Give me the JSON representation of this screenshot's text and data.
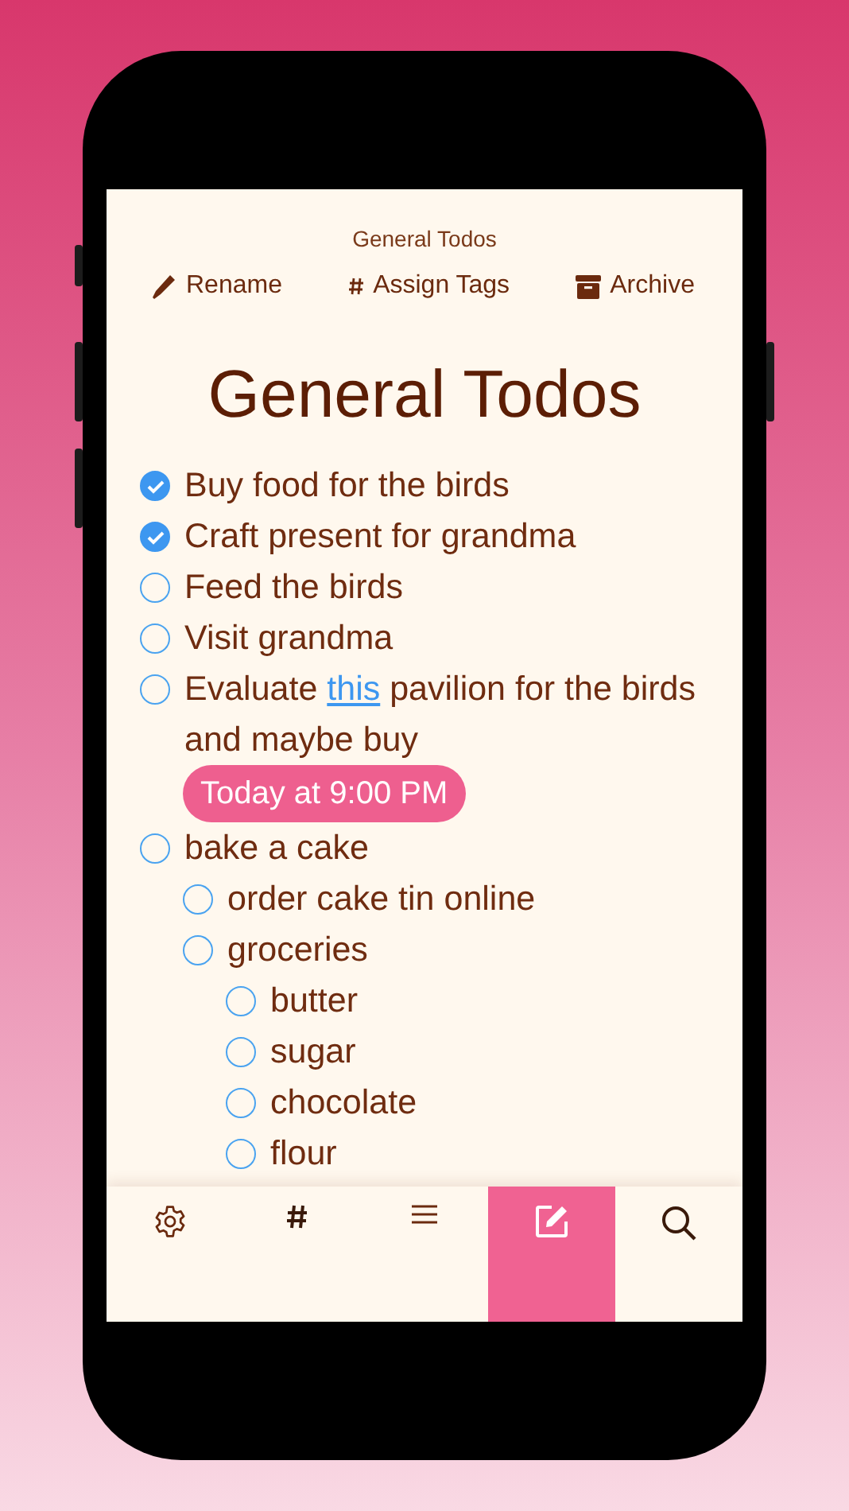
{
  "header": {
    "title": "General Todos",
    "actions": [
      {
        "kind": "rename",
        "label": "Rename"
      },
      {
        "kind": "tags",
        "label": "Assign Tags"
      },
      {
        "kind": "archive",
        "label": "Archive"
      }
    ]
  },
  "note_title": "General Todos",
  "todos": [
    {
      "segments": [
        {
          "text": "Buy food for the birds"
        }
      ],
      "checked": true
    },
    {
      "segments": [
        {
          "text": "Craft present for grandma"
        }
      ],
      "checked": true
    },
    {
      "segments": [
        {
          "text": "Feed the birds"
        }
      ],
      "checked": false
    },
    {
      "segments": [
        {
          "text": "Visit grandma"
        }
      ],
      "checked": false
    },
    {
      "segments": [
        {
          "text": "Evaluate "
        },
        {
          "text": "this",
          "kind": "link"
        },
        {
          "text": " pavilion for the birds and maybe buy"
        }
      ],
      "checked": false,
      "reminder": "Today at 9:00 PM"
    },
    {
      "segments": [
        {
          "text": "bake a cake"
        }
      ],
      "checked": false,
      "children": [
        {
          "segments": [
            {
              "text": "order cake tin online"
            }
          ],
          "checked": false
        },
        {
          "segments": [
            {
              "text": "groceries"
            }
          ],
          "checked": false,
          "children": [
            {
              "segments": [
                {
                  "text": "butter"
                }
              ],
              "checked": false
            },
            {
              "segments": [
                {
                  "text": "sugar"
                }
              ],
              "checked": false
            },
            {
              "segments": [
                {
                  "text": "chocolate"
                }
              ],
              "checked": false
            },
            {
              "segments": [
                {
                  "text": "flour"
                }
              ],
              "checked": false
            }
          ]
        }
      ]
    }
  ],
  "tab_bar": [
    {
      "kind": "settings",
      "selected": false
    },
    {
      "kind": "tags",
      "selected": false
    },
    {
      "kind": "list",
      "selected": false
    },
    {
      "kind": "edit",
      "selected": true
    },
    {
      "kind": "search",
      "selected": false
    }
  ]
}
